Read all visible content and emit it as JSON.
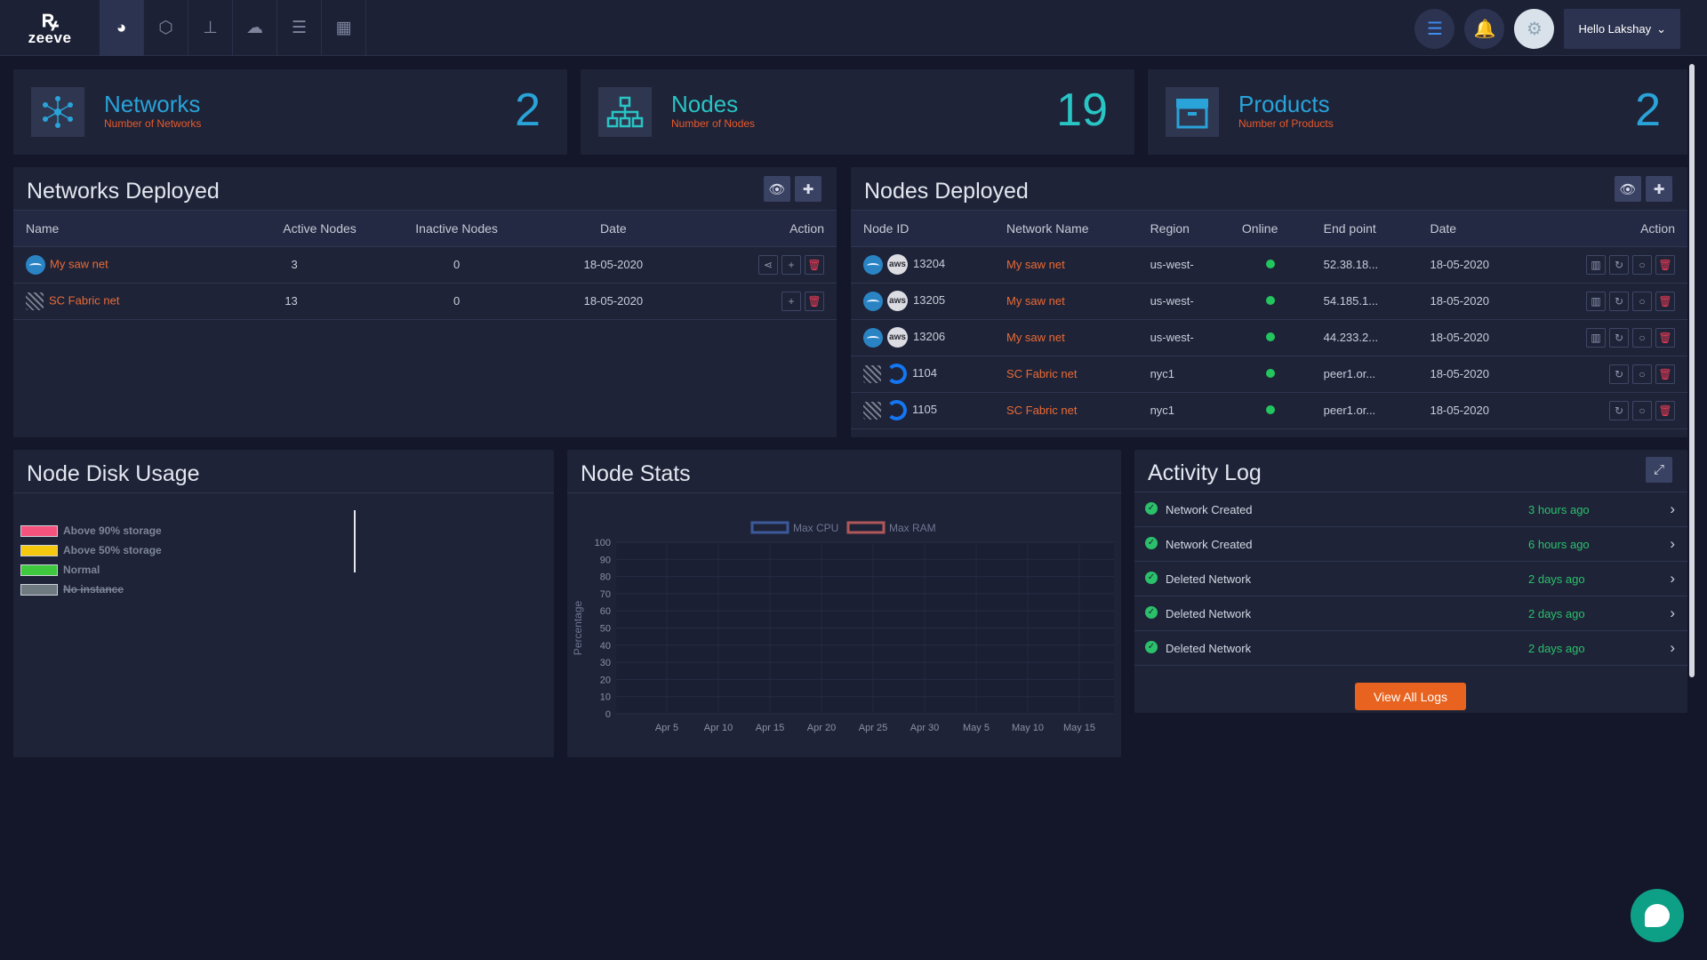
{
  "app": {
    "logo_text": "zeeve",
    "logo_mark": "ꝶ"
  },
  "nav": {
    "icons": [
      "dashboard-icon",
      "hexagon-icon",
      "sitemap-icon",
      "cloud-upload-icon",
      "server-icon",
      "grid-icon"
    ],
    "user_label": "Hello Lakshay"
  },
  "cards": [
    {
      "title": "Networks",
      "subtitle": "Number of Networks",
      "count": "2"
    },
    {
      "title": "Nodes",
      "subtitle": "Number of Nodes",
      "count": "19"
    },
    {
      "title": "Products",
      "subtitle": "Number of Products",
      "count": "2"
    }
  ],
  "networks_panel": {
    "title": "Networks Deployed",
    "columns": [
      "Name",
      "Active Nodes",
      "Inactive Nodes",
      "Date",
      "Action"
    ],
    "rows": [
      {
        "name": "My saw net",
        "active": "3",
        "inactive": "0",
        "date": "18-05-2020"
      },
      {
        "name": "SC Fabric net",
        "active": "13",
        "inactive": "0",
        "date": "18-05-2020"
      }
    ]
  },
  "nodes_panel": {
    "title": "Nodes Deployed",
    "columns": [
      "Node ID",
      "Network Name",
      "Region",
      "Online",
      "End point",
      "Date",
      "Action"
    ],
    "rows": [
      {
        "id": "13204",
        "network": "My saw net",
        "region": "us-west-",
        "endpoint": "52.38.18...",
        "date": "18-05-2020",
        "provider": "aws"
      },
      {
        "id": "13205",
        "network": "My saw net",
        "region": "us-west-",
        "endpoint": "54.185.1...",
        "date": "18-05-2020",
        "provider": "aws"
      },
      {
        "id": "13206",
        "network": "My saw net",
        "region": "us-west-",
        "endpoint": "44.233.2...",
        "date": "18-05-2020",
        "provider": "aws"
      },
      {
        "id": "1104",
        "network": "SC Fabric net",
        "region": "nyc1",
        "endpoint": "peer1.or...",
        "date": "18-05-2020",
        "provider": "digitalocean"
      },
      {
        "id": "1105",
        "network": "SC Fabric net",
        "region": "nyc1",
        "endpoint": "peer1.or...",
        "date": "18-05-2020",
        "provider": "digitalocean"
      }
    ]
  },
  "disk_panel": {
    "title": "Node Disk Usage",
    "legend": [
      {
        "label": "Above 90% storage",
        "color": "#f5527e"
      },
      {
        "label": "Above 50% storage",
        "color": "#f6c90e"
      },
      {
        "label": "Normal",
        "color": "#3ec93e"
      },
      {
        "label": "No instance",
        "color": "#6e7a80"
      }
    ]
  },
  "stats_panel": {
    "title": "Node Stats",
    "chart_data": {
      "type": "line",
      "title": "",
      "xlabel": "",
      "ylabel": "Percentage",
      "ylim": [
        0,
        100
      ],
      "yticks": [
        0,
        10,
        20,
        30,
        40,
        50,
        60,
        70,
        80,
        90,
        100
      ],
      "categories": [
        "Apr 5",
        "Apr 10",
        "Apr 15",
        "Apr 20",
        "Apr 25",
        "Apr 30",
        "May 5",
        "May 10",
        "May 15"
      ],
      "series": [
        {
          "name": "Max CPU",
          "color": "#3c5a9a",
          "values": []
        },
        {
          "name": "Max RAM",
          "color": "#b0575a",
          "values": []
        }
      ],
      "legend": "top-center",
      "grid": true
    }
  },
  "activity_panel": {
    "title": "Activity Log",
    "items": [
      {
        "text": "Network Created",
        "when": "3 hours ago"
      },
      {
        "text": "Network Created",
        "when": "6 hours ago"
      },
      {
        "text": "Deleted Network",
        "when": "2 days ago"
      },
      {
        "text": "Deleted Network",
        "when": "2 days ago"
      },
      {
        "text": "Deleted Network",
        "when": "2 days ago"
      }
    ],
    "view_all_label": "View All Logs"
  }
}
